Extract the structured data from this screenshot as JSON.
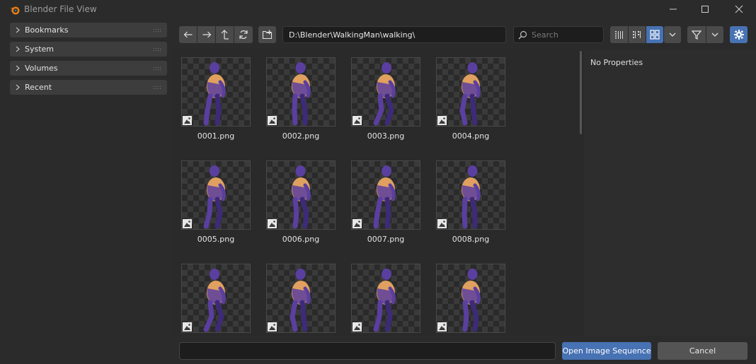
{
  "window": {
    "title": "Blender File View"
  },
  "sidebar": {
    "items": [
      {
        "label": "Bookmarks"
      },
      {
        "label": "System"
      },
      {
        "label": "Volumes"
      },
      {
        "label": "Recent"
      }
    ]
  },
  "toolbar": {
    "path": "D:\\Blender\\WalkingMan\\walking\\",
    "search_placeholder": "Search"
  },
  "files": [
    {
      "name": "0001.png"
    },
    {
      "name": "0002.png"
    },
    {
      "name": "0003.png"
    },
    {
      "name": "0004.png"
    },
    {
      "name": "0005.png"
    },
    {
      "name": "0006.png"
    },
    {
      "name": "0007.png"
    },
    {
      "name": "0008.png"
    },
    {
      "name": ""
    },
    {
      "name": ""
    },
    {
      "name": ""
    },
    {
      "name": ""
    }
  ],
  "properties": {
    "empty_text": "No Properties"
  },
  "footer": {
    "filename_value": "",
    "open_label": "Open Image Sequence",
    "cancel_label": "Cancel"
  },
  "colors": {
    "accent": "#4772b3",
    "figure_body": "#5a3fa0",
    "figure_skin": "#e0a060"
  }
}
